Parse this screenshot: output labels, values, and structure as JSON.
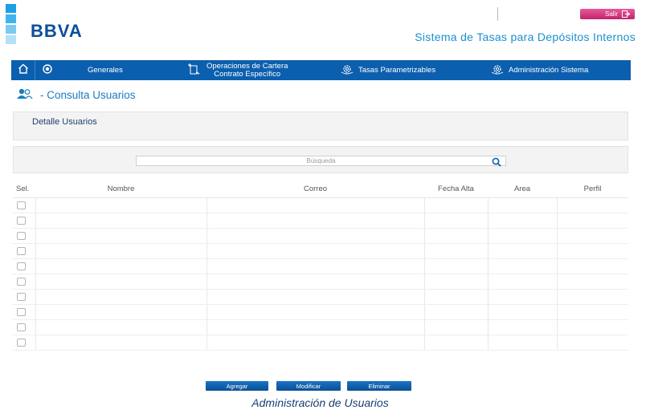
{
  "colors": {
    "brand_blue": "#0b4e9b",
    "nav_bg": "#0c5fae",
    "accent_light_blue": "#1a8fd0",
    "logout_pink": "#d63b82",
    "logo_bar_colors": [
      "#1aa0e6",
      "#3fb4ee",
      "#7acaf3",
      "#b4e0f8"
    ]
  },
  "header": {
    "logo": "BBVA",
    "logout_label": "Salir",
    "logout_icon": "exit-icon",
    "app_title": "Sistema de Tasas para Depósitos Internos"
  },
  "nav": {
    "home_icon": "home-icon",
    "eye_icon": "eye-icon",
    "items": [
      {
        "label": "Generales",
        "icon": ""
      },
      {
        "label_line1": "Operaciones de Cartera",
        "label_line2": "Contrato Específico",
        "icon": "contract-icon"
      },
      {
        "label": "Tasas Parametrizables",
        "icon": "gear-icon"
      },
      {
        "label": "Administración Sistema",
        "icon": "gear-icon"
      }
    ]
  },
  "page": {
    "title": "- Consulta Usuarios",
    "title_icon": "users-icon"
  },
  "detail_panel": {
    "label": "Detalle Usuarios"
  },
  "search": {
    "placeholder": "Búsqueda",
    "icon": "search-icon"
  },
  "table": {
    "columns": [
      "Sel.",
      "Nombre",
      "Correo",
      "Fecha Alta",
      "Area",
      "Perfil"
    ],
    "rows": [
      {
        "checked": false
      },
      {
        "checked": false
      },
      {
        "checked": false
      },
      {
        "checked": false
      },
      {
        "checked": false
      },
      {
        "checked": false
      },
      {
        "checked": false
      },
      {
        "checked": false
      },
      {
        "checked": false
      },
      {
        "checked": false
      }
    ]
  },
  "actions": {
    "add_label": "Agregar",
    "modify_label": "Modificar",
    "delete_label": "Eliminar"
  },
  "caption": "Administración de Usuarios"
}
